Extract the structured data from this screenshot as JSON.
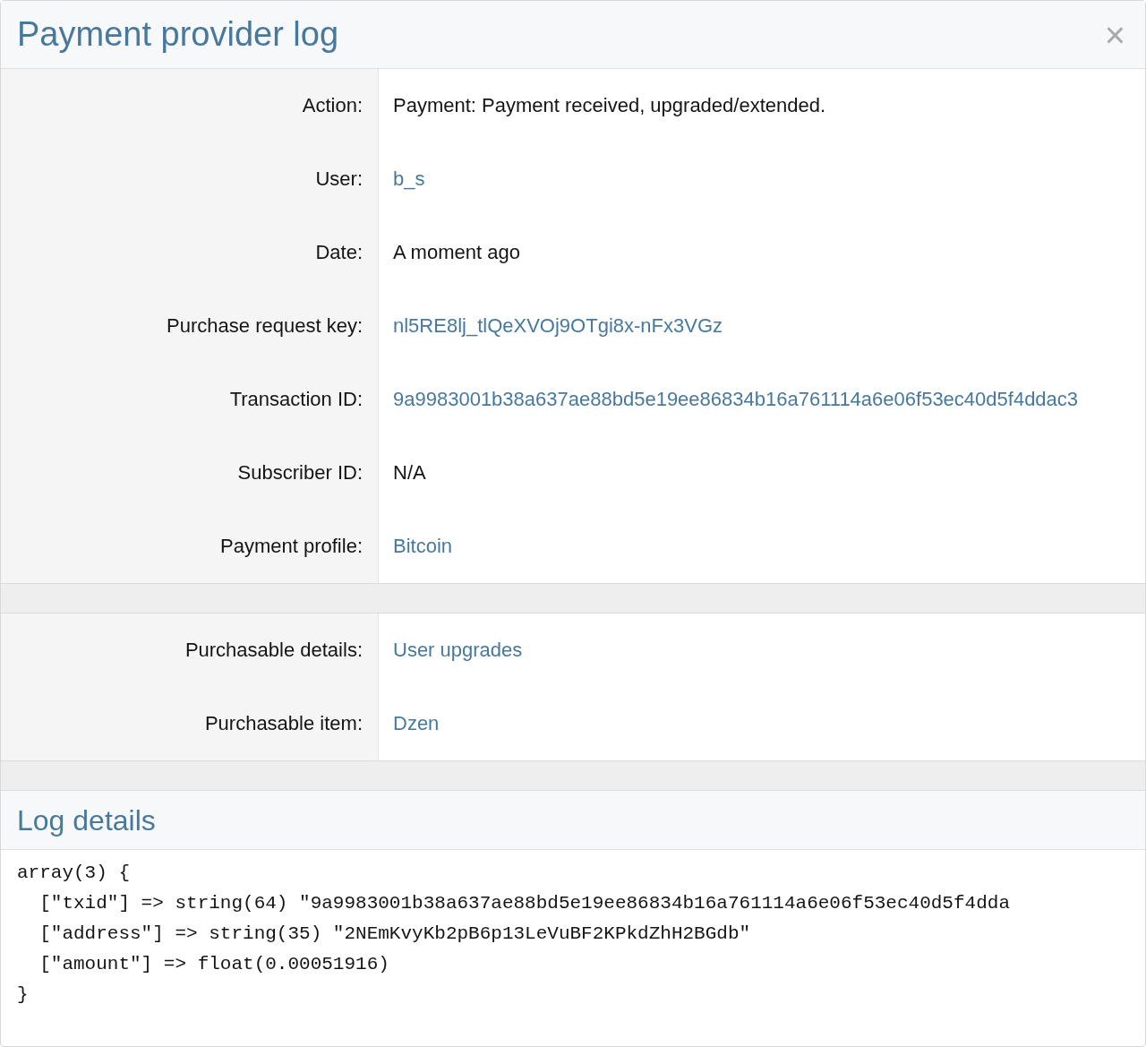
{
  "dialog": {
    "title": "Payment provider log",
    "close": "×"
  },
  "sections": [
    {
      "rows": [
        {
          "label": "Action:",
          "value": "Payment: Payment received, upgraded/extended.",
          "kind": "text"
        },
        {
          "label": "User:",
          "value": "b_s",
          "kind": "link"
        },
        {
          "label": "Date:",
          "value": "A moment ago",
          "kind": "text"
        },
        {
          "label": "Purchase request key:",
          "value": "nl5RE8lj_tlQeXVOj9OTgi8x-nFx3VGz",
          "kind": "link"
        },
        {
          "label": "Transaction ID:",
          "value": "9a9983001b38a637ae88bd5e19ee86834b16a761114a6e06f53ec40d5f4ddac3",
          "kind": "link"
        },
        {
          "label": "Subscriber ID:",
          "value": "N/A",
          "kind": "text"
        },
        {
          "label": "Payment profile:",
          "value": "Bitcoin",
          "kind": "link"
        }
      ]
    },
    {
      "rows": [
        {
          "label": "Purchasable details:",
          "value": "User upgrades",
          "kind": "link"
        },
        {
          "label": "Purchasable item:",
          "value": "Dzen",
          "kind": "link"
        }
      ]
    }
  ],
  "log_details": {
    "title": "Log details",
    "lines": [
      "array(3) {",
      "  [\"txid\"] => string(64) \"9a9983001b38a637ae88bd5e19ee86834b16a761114a6e06f53ec40d5f4dda",
      "  [\"address\"] => string(35) \"2NEmKvyKb2pB6p13LeVuBF2KPkdZhH2BGdb\"",
      "  [\"amount\"] => float(0.00051916)",
      "}"
    ]
  }
}
